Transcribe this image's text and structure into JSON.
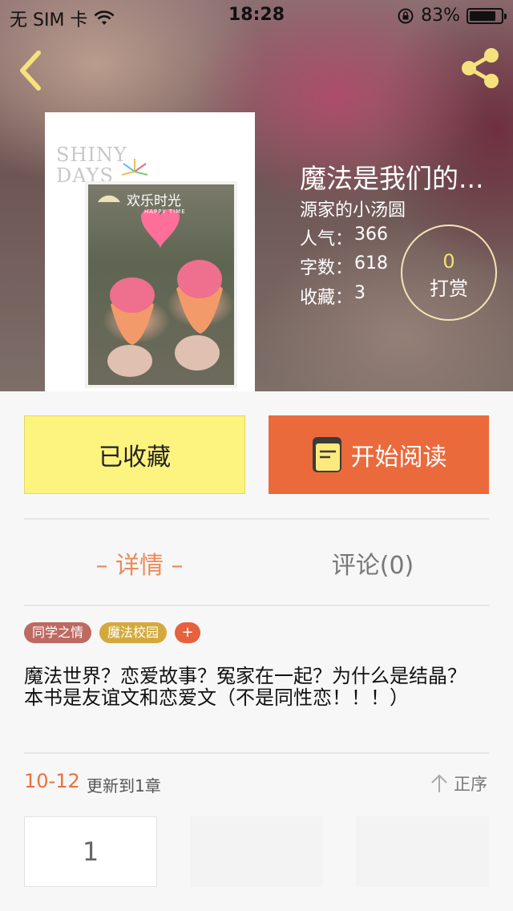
{
  "status_bar": {
    "carrier": "无 SIM 卡",
    "time": "18:28",
    "battery_percent": "83%",
    "battery_level": 0.83
  },
  "nav": {
    "back_icon": "chevron-left-icon",
    "share_icon": "share-icon"
  },
  "cover": {
    "shiny_line1": "SHINY",
    "shiny_line2": "DAYS",
    "caption": "欢乐时光",
    "caption_sub": "HAPPY TIME"
  },
  "book": {
    "title": "魔法是我们的...",
    "author": "源家的小汤圆",
    "stats": [
      {
        "label": "人气：",
        "value": "366"
      },
      {
        "label": "字数：",
        "value": "618"
      },
      {
        "label": "收藏：",
        "value": "3"
      }
    ],
    "reward": {
      "count": "0",
      "label": "打赏"
    }
  },
  "actions": {
    "collected_label": "已收藏",
    "read_label": "开始阅读"
  },
  "tabs": {
    "detail": "– 详情 –",
    "comments": "评论(0)"
  },
  "tags": [
    "同学之情",
    "魔法校园"
  ],
  "tag_add": "+",
  "description": {
    "line1": "魔法世界？恋爱故事？冤家在一起？为什么是结晶？",
    "line2": "本书是友谊文和恋爱文（不是同性恋！！！）"
  },
  "updates": {
    "date": "10-12",
    "text": "更新到1章",
    "sort_label": "正序"
  },
  "chapters": [
    "1"
  ],
  "colors": {
    "accent_orange": "#ea6a3c",
    "collected_yellow": "#fdf37f",
    "tab_active": "#ea8a5a",
    "update_orange": "#e8713e"
  }
}
